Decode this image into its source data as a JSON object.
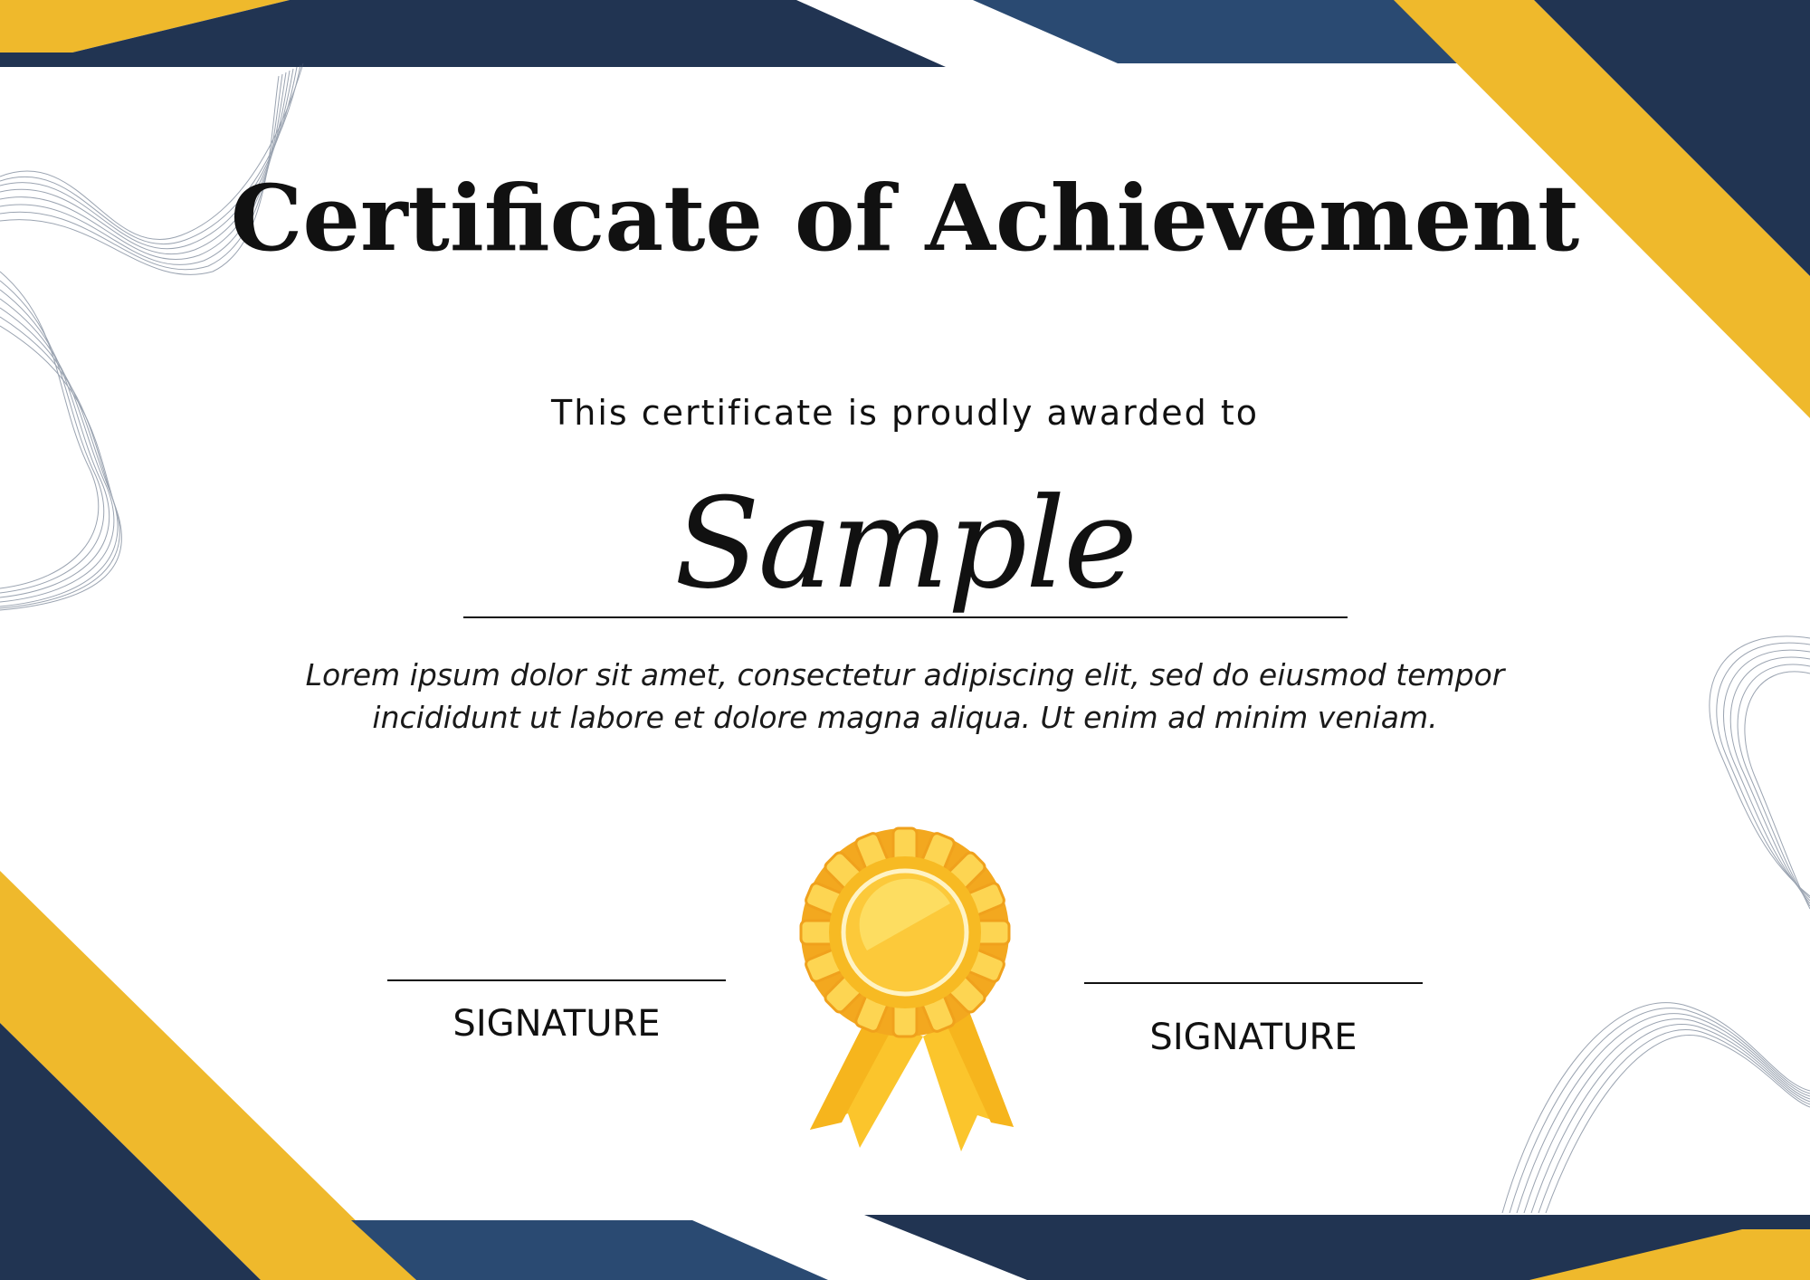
{
  "certificate": {
    "title": "Certificate of Achievement",
    "subtitle": "This certificate is proudly awarded to",
    "recipient": "Sample",
    "description_lines": [
      "Lorem ipsum dolor sit amet, consectetur adipiscing elit, sed do eiusmod tempor",
      "incididunt ut labore et dolore magna aliqua. Ut enim ad minim veniam."
    ],
    "signatures": [
      {
        "label": "SIGNATURE"
      },
      {
        "label": "SIGNATURE"
      }
    ]
  },
  "colors": {
    "navy": "#213452",
    "blue": "#2a4a72",
    "gold": "#efb92c",
    "text": "#111111"
  },
  "icons": {
    "seal": "award-rosette-icon",
    "decoration": "wave-lines-ornament"
  }
}
